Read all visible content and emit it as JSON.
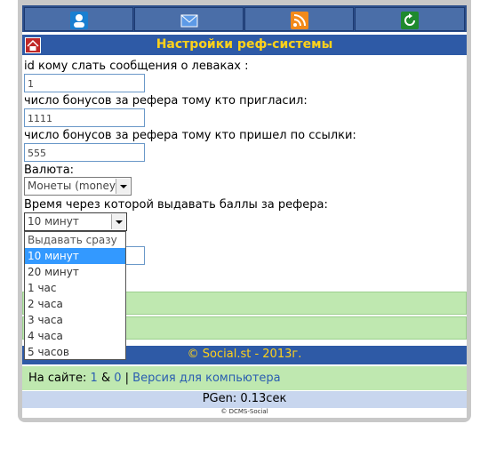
{
  "nav": {
    "icons": [
      "user-icon",
      "mail-icon",
      "rss-icon",
      "refresh-icon"
    ],
    "colors": {
      "user": "#1a7fd1",
      "mail": "#3a78d8",
      "rss": "#f28a1a",
      "refresh": "#1f8a2e"
    }
  },
  "header": {
    "title": "Настройки реф-системы"
  },
  "form": {
    "field1_label": "id кому слать сообщения о леваках :",
    "field1_value": "1",
    "field2_label": "число бонусов за рефера тому кто пригласил:",
    "field2_value": "1111",
    "field3_label": "число бонусов за рефера тому кто пришел по ссылки:",
    "field3_value": "555",
    "currency_label": "Валюта:",
    "currency_value": "Монеты (money)",
    "time_label": "Время через которой выдавать баллы за рефера:",
    "time_value": "10 минут",
    "hidden_label_tail": ":"
  },
  "dropdown": {
    "options": [
      "Выдавать сразу",
      "10 минут",
      "20 минут",
      "1 час",
      "2 часа",
      "3 часа",
      "4 часа",
      "5 часов"
    ],
    "selected_index": 1
  },
  "footer": {
    "copyright": "© Social.st - 2013г.",
    "online_label": "На сайте:",
    "online_count1": "1",
    "online_amp": " & ",
    "online_count2": "0",
    "separator": " | ",
    "desktop_link": "Версия для компьютера",
    "pgen": "PGen: 0.13сек",
    "engine": "© DCMS-Social"
  }
}
